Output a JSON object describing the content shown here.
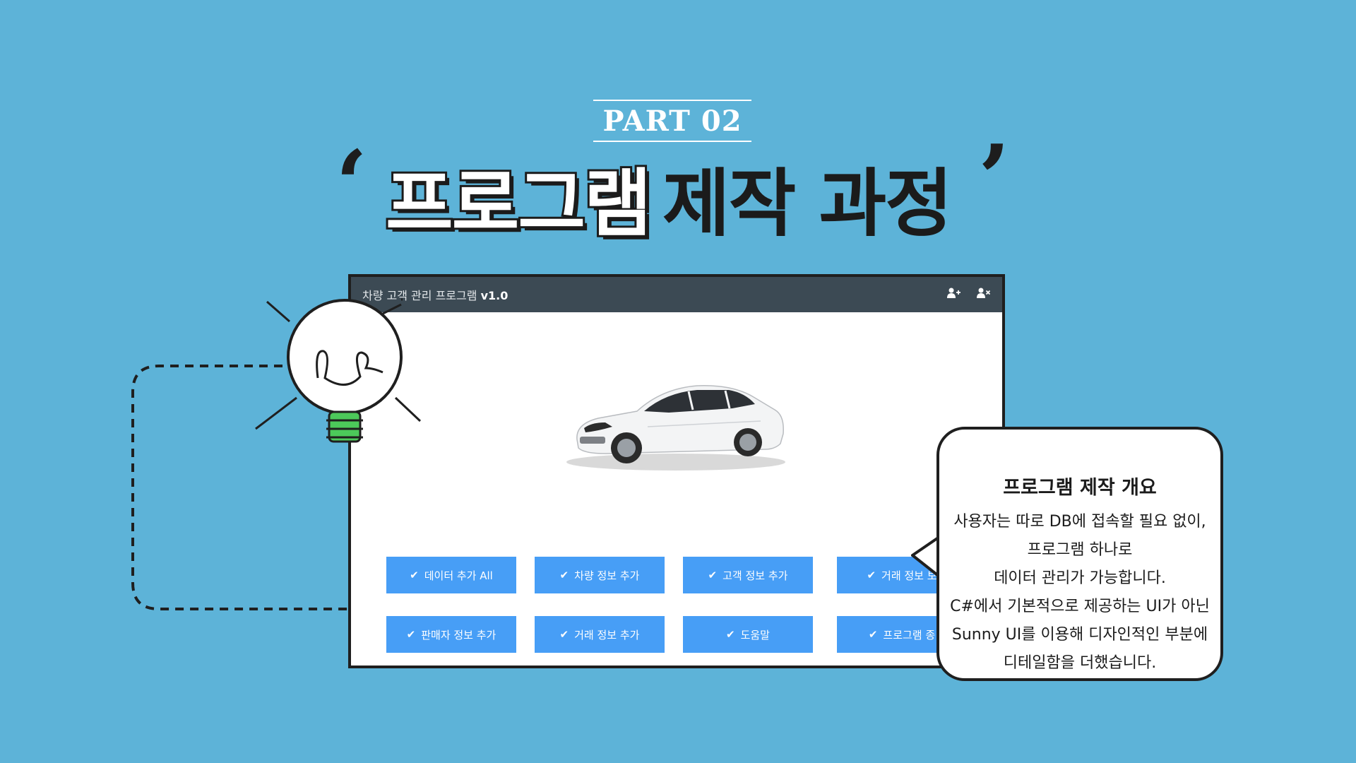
{
  "header": {
    "part_label": "PART 02",
    "quote_open": "‘",
    "quote_close": "’",
    "title_highlight": "프로그램",
    "title_rest": "제작 과정"
  },
  "app": {
    "title_prefix": "차량 고객 관리 프로그램",
    "title_version": "v1.0",
    "icons": [
      "user-plus-icon",
      "user-times-icon"
    ],
    "buttons": [
      {
        "label": "데이터 추가 All"
      },
      {
        "label": "차량 정보 추가"
      },
      {
        "label": "고객 정보 추가"
      },
      {
        "label": "거래 정보 보"
      },
      {
        "label": "판매자 정보 추가"
      },
      {
        "label": "거래 정보 추가"
      },
      {
        "label": "도움말"
      },
      {
        "label": "프로그램 종"
      }
    ],
    "check_glyph": "✔"
  },
  "bubble": {
    "heading": "프로그램 제작 개요",
    "lines": [
      "사용자는 따로 DB에 접속할 필요 없이,",
      "프로그램 하나로",
      "데이터 관리가 가능합니다.",
      "C#에서 기본적으로 제공하는 UI가 아닌",
      "Sunny UI를 이용해 디자인적인 부분에",
      "디테일함을 더했습니다."
    ]
  },
  "colors": {
    "background": "#5db3d8",
    "button": "#479ef6",
    "titlebar": "#3c4a54",
    "bulb_base": "#4cc95a",
    "outline": "#1f1f1f"
  }
}
